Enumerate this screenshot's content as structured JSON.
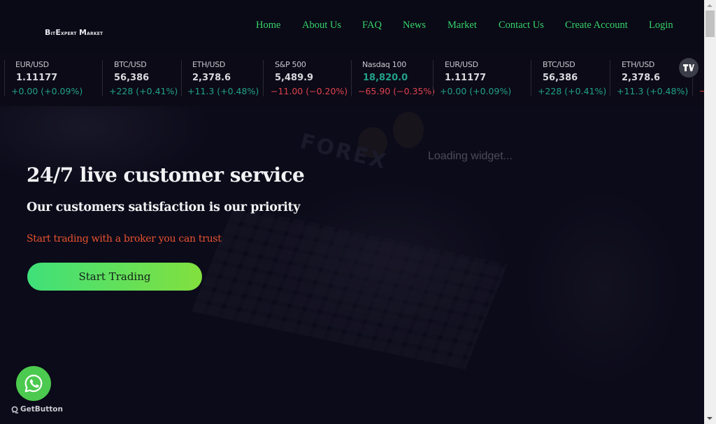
{
  "brand": {
    "logo_text": "BitExpert Market"
  },
  "nav": {
    "items": [
      {
        "label": "Home"
      },
      {
        "label": "About Us"
      },
      {
        "label": "FAQ"
      },
      {
        "label": "News"
      },
      {
        "label": "Market"
      },
      {
        "label": "Contact Us"
      },
      {
        "label": "Create Account"
      },
      {
        "label": "Login"
      }
    ]
  },
  "ticker": {
    "items": [
      {
        "symbol": "EUR/USD",
        "price": "1.11177",
        "change": "+0.00 (+0.09%)",
        "direction": "up"
      },
      {
        "symbol": "BTC/USD",
        "price": "56,386",
        "change": "+228 (+0.41%)",
        "direction": "up"
      },
      {
        "symbol": "ETH/USD",
        "price": "2,378.6",
        "change": "+11.3 (+0.48%)",
        "direction": "up"
      },
      {
        "symbol": "S&P 500",
        "price": "5,489.9",
        "change": "−11.00 (−0.20%)",
        "direction": "down"
      },
      {
        "symbol": "Nasdaq 100",
        "price": "18,820.0",
        "change": "−65.90 (−0.35%)",
        "direction": "down",
        "price_color": "#22a08a"
      },
      {
        "symbol": "EUR/USD",
        "price": "1.11177",
        "change": "+0.00 (+0.09%)",
        "direction": "up"
      },
      {
        "symbol": "BTC/USD",
        "price": "56,386",
        "change": "+228 (+0.41%)",
        "direction": "up"
      },
      {
        "symbol": "ETH/USD",
        "price": "2,378.6",
        "change": "+11.3 (+0.48%)",
        "direction": "up"
      }
    ],
    "badge_label": "TV",
    "colors": {
      "up": "#22a08a",
      "down": "#e0424f"
    }
  },
  "hero": {
    "title": "24/7 live customer service",
    "subtitle": "Our customers satisfaction is our priority",
    "tagline": "Start trading with a broker you can trust",
    "cta_label": "Start Trading",
    "background_text": "FOREX",
    "widget_loading_text": "Loading widget..."
  },
  "floating": {
    "whatsapp_icon": "whatsapp-icon",
    "getbutton_label": "GetButton"
  },
  "colors": {
    "nav_link": "#35d46a",
    "tagline": "#e8532e",
    "cta_gradient_start": "#3fe07a",
    "cta_gradient_end": "#82e03e",
    "whatsapp": "#4cc94f"
  }
}
